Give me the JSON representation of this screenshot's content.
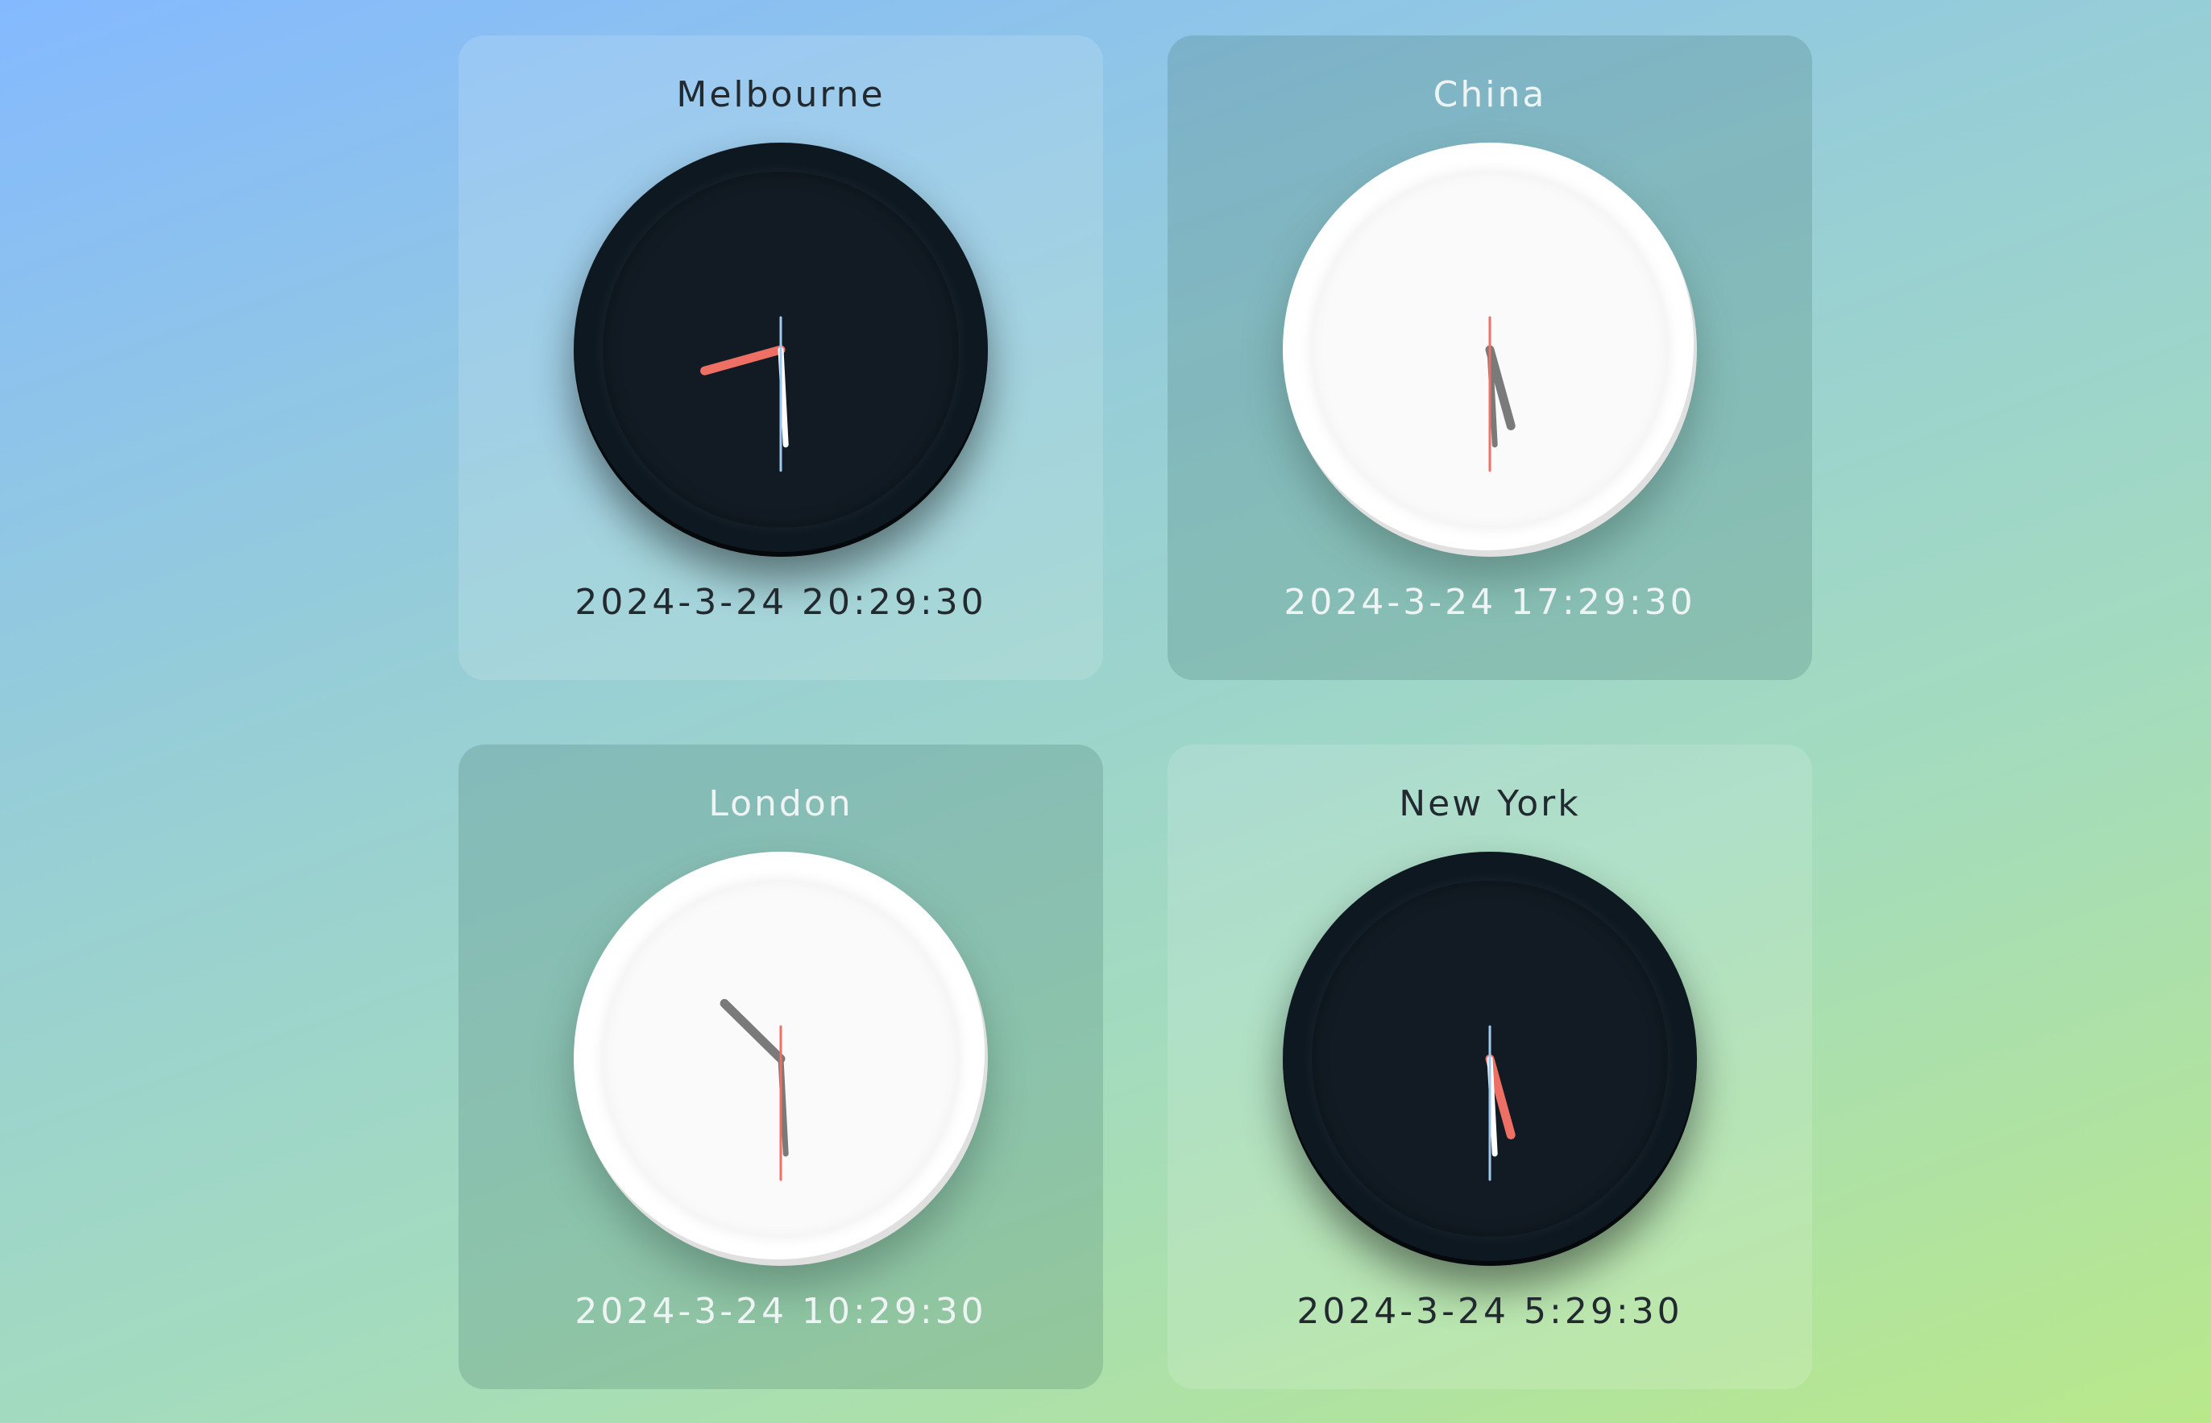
{
  "clocks": [
    {
      "city": "Melbourne",
      "datetime": "2024-3-24 20:29:30",
      "face": "dark",
      "hour": 20,
      "minute": 29,
      "second": 30,
      "colors": {
        "hour": "#ee6f63",
        "minute": "#ffffff",
        "second": "#9ec9ec"
      }
    },
    {
      "city": "China",
      "datetime": "2024-3-24 17:29:30",
      "face": "light",
      "hour": 17,
      "minute": 29,
      "second": 30,
      "colors": {
        "hour": "#7a7a7a",
        "minute": "#7a7a7a",
        "second": "#ee6f63"
      }
    },
    {
      "city": "London",
      "datetime": "2024-3-24 10:29:30",
      "face": "light",
      "hour": 10,
      "minute": 29,
      "second": 30,
      "colors": {
        "hour": "#7a7a7a",
        "minute": "#7a7a7a",
        "second": "#ee6f63"
      }
    },
    {
      "city": "New York",
      "datetime": "2024-3-24 5:29:30",
      "face": "dark",
      "hour": 5,
      "minute": 29,
      "second": 30,
      "colors": {
        "hour": "#ee6f63",
        "minute": "#ffffff",
        "second": "#9ec9ec"
      }
    }
  ]
}
